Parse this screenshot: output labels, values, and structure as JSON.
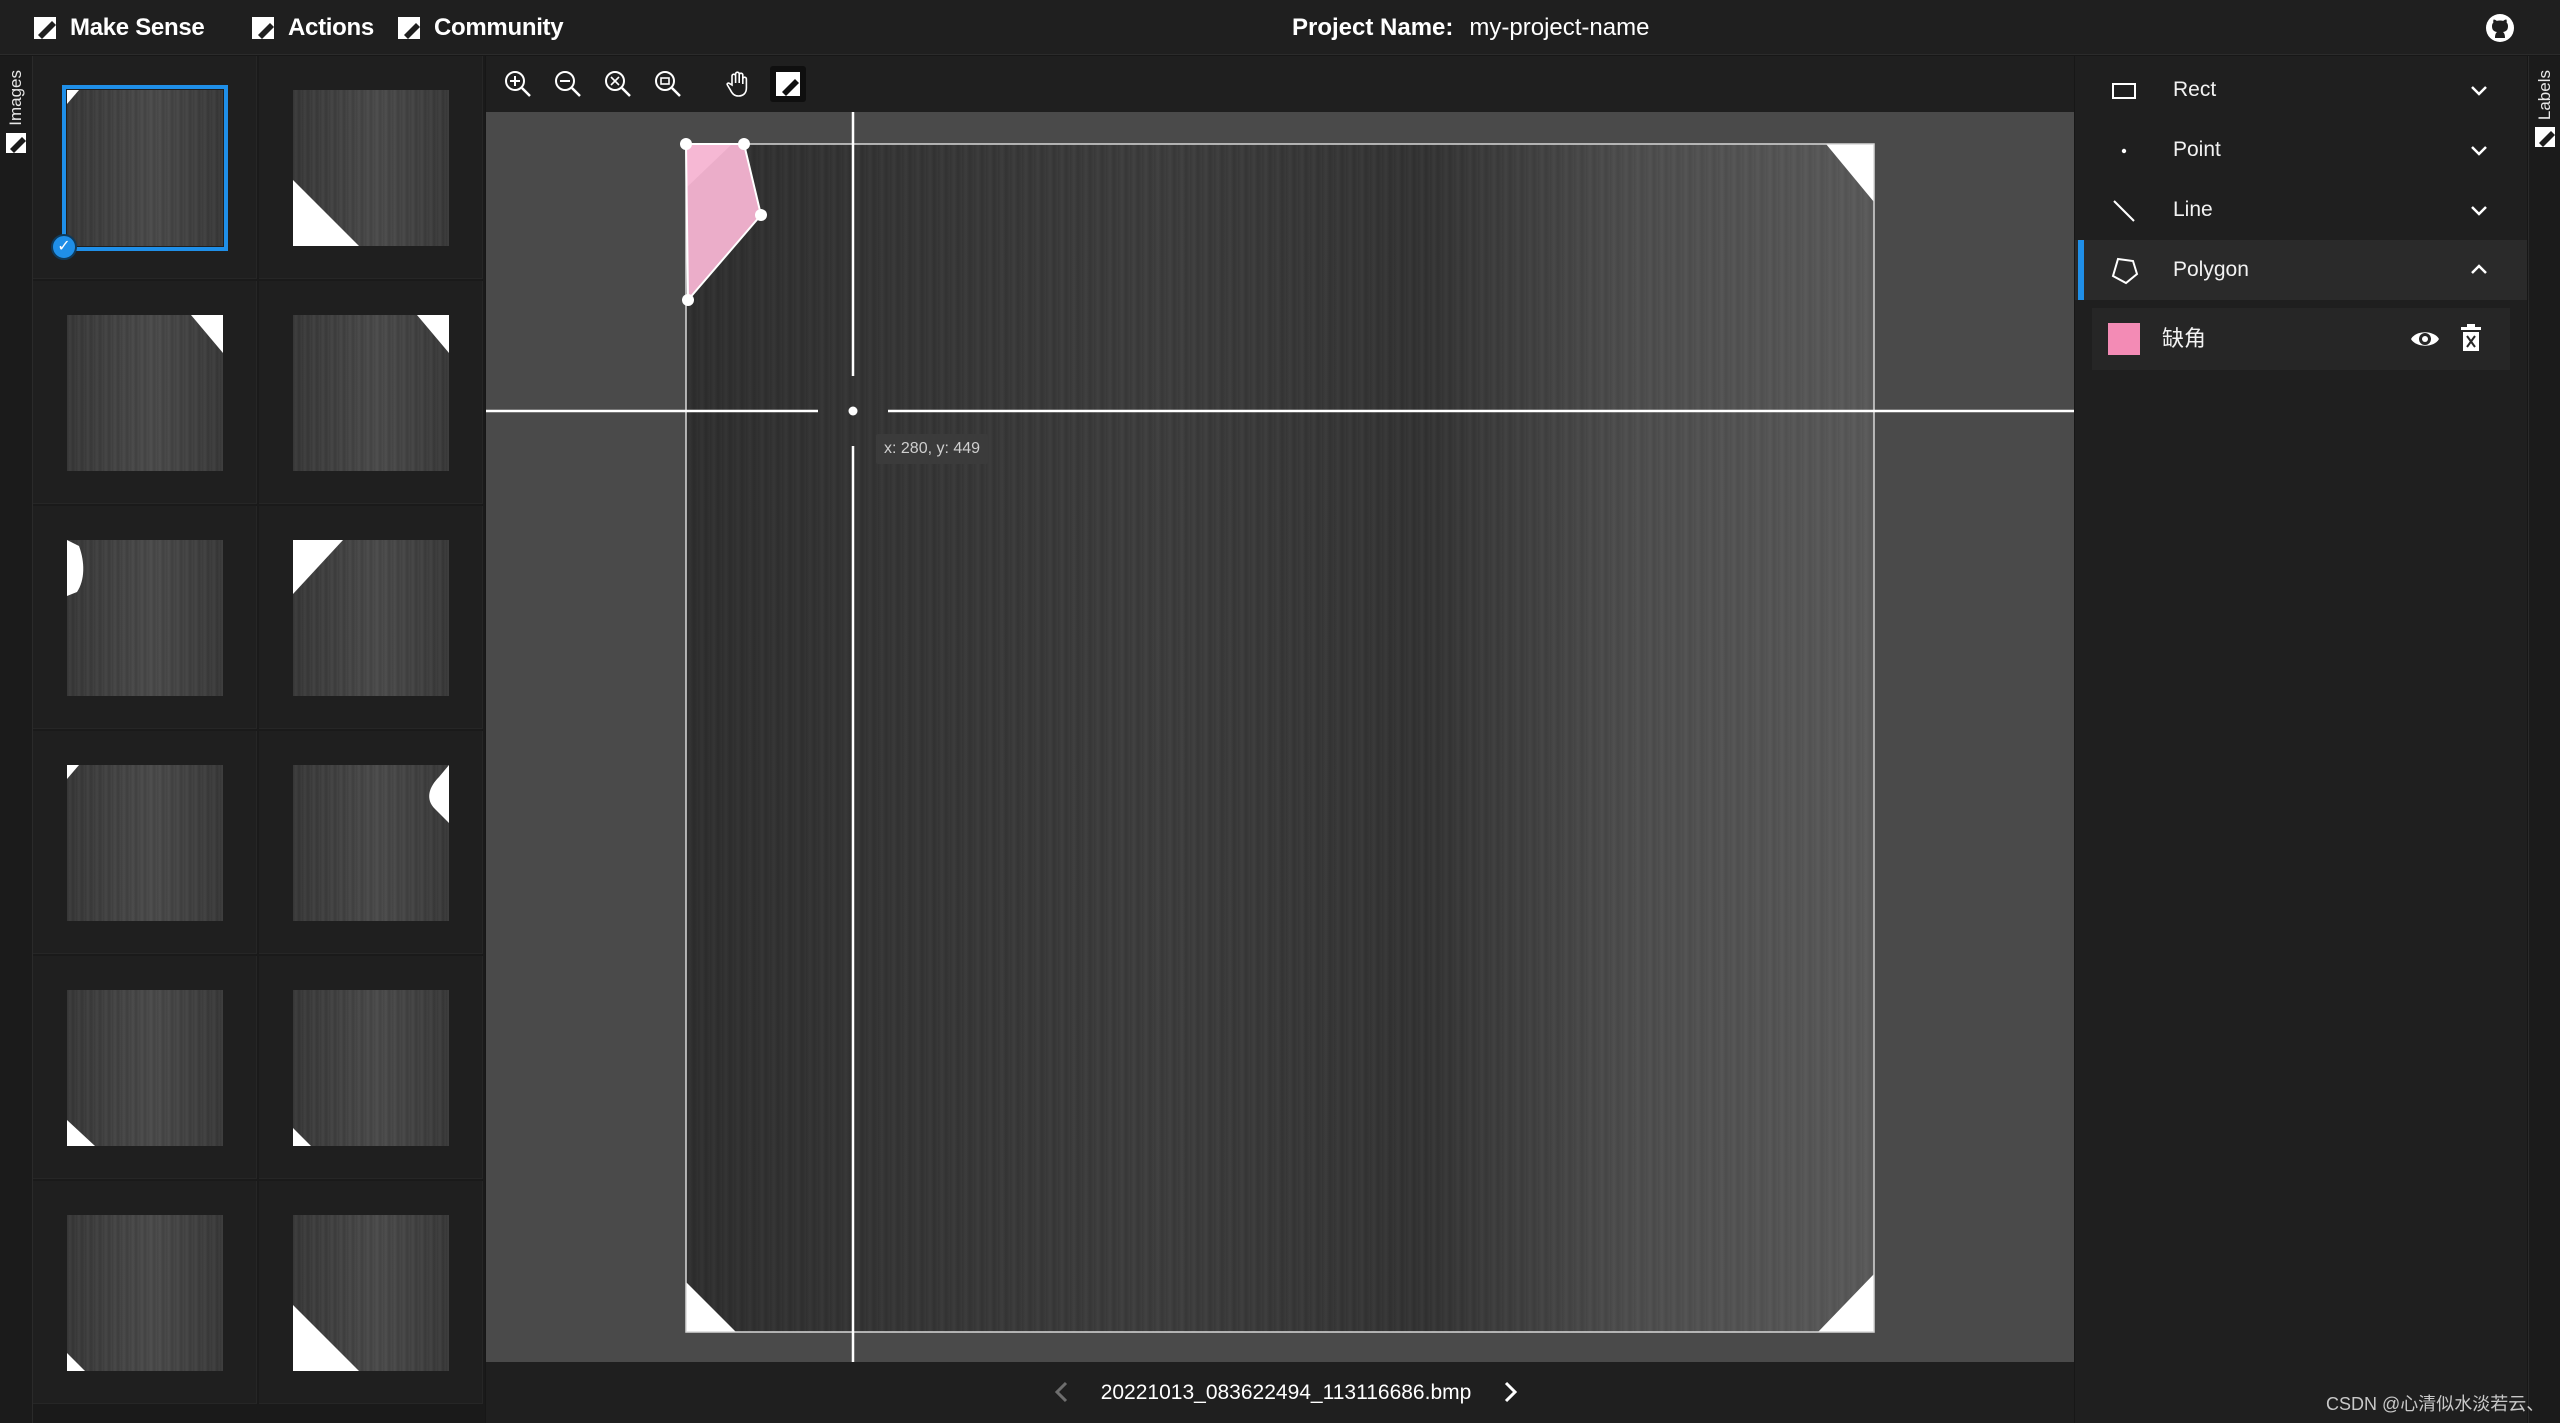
{
  "app": {
    "brand": "Make Sense",
    "menu": [
      "Actions",
      "Community"
    ],
    "project_label": "Project Name:",
    "project_value": "my-project-name"
  },
  "sidebars": {
    "left_tab": "Images",
    "right_tab": "Labels"
  },
  "thumbnails": [
    {
      "corner": "top-left-small",
      "selected": true
    },
    {
      "corner": "bottom-left-large",
      "selected": false
    },
    {
      "corner": "top-right",
      "selected": false
    },
    {
      "corner": "top-right",
      "selected": false
    },
    {
      "corner": "left-edge-notch",
      "selected": false
    },
    {
      "corner": "top-left-large",
      "selected": false
    },
    {
      "corner": "top-left-small",
      "selected": false
    },
    {
      "corner": "right-edge-notch",
      "selected": false
    },
    {
      "corner": "bottom-left",
      "selected": false
    },
    {
      "corner": "bottom-left-small",
      "selected": false
    },
    {
      "corner": "bottom-left-small",
      "selected": false
    },
    {
      "corner": "bottom-left-large",
      "selected": false
    }
  ],
  "toolbar": {
    "tools": [
      "zoom-in",
      "zoom-out",
      "zoom-fit",
      "zoom-reset",
      "pan",
      "select"
    ],
    "active_tool": "select"
  },
  "editor": {
    "cursor_readout": "x: 280, y: 449",
    "filename": "20221013_083622494_113116686.bmp"
  },
  "label_types": [
    {
      "name": "Rect",
      "icon": "rect-icon",
      "expanded": false,
      "active": false
    },
    {
      "name": "Point",
      "icon": "point-icon",
      "expanded": false,
      "active": false
    },
    {
      "name": "Line",
      "icon": "line-icon",
      "expanded": false,
      "active": false
    },
    {
      "name": "Polygon",
      "icon": "polygon-icon",
      "expanded": true,
      "active": true
    }
  ],
  "labels": [
    {
      "name": "缺角",
      "color": "#f38bb5"
    }
  ],
  "colors": {
    "accent": "#1f8fe8",
    "label": "#f38bb5"
  },
  "watermark": "CSDN @心清似水淡若云、"
}
